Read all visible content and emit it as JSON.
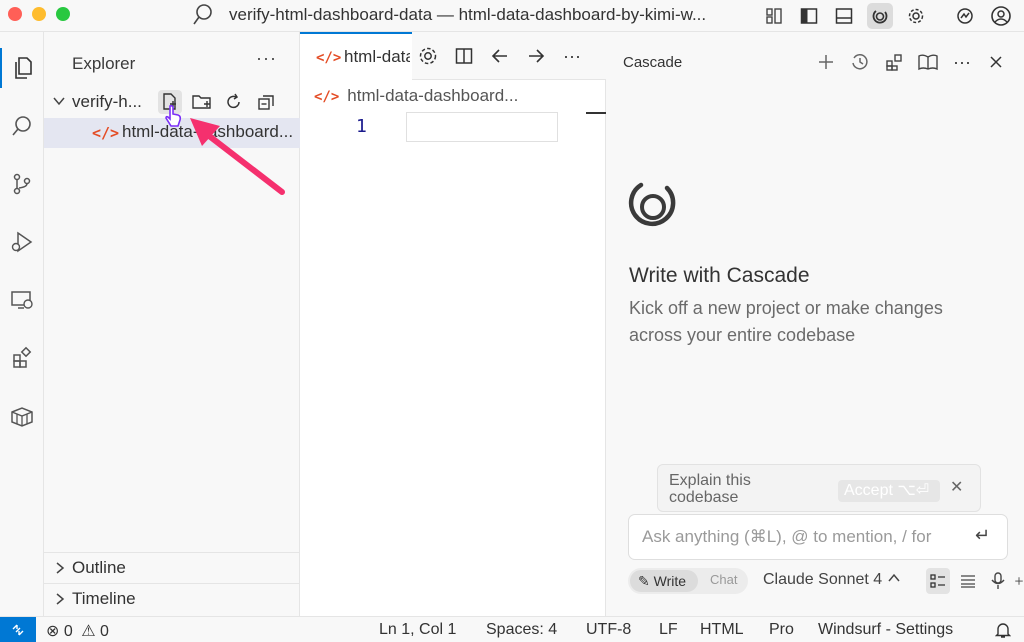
{
  "titlebar": {
    "title": "verify-html-dashboard-data — html-data-dashboard-by-kimi-w..."
  },
  "activity_bar": {
    "items": [
      "explorer-icon",
      "search-icon",
      "source-control-icon",
      "run-debug-icon",
      "remote-explorer-icon",
      "extensions-icon",
      "containers-icon"
    ]
  },
  "explorer": {
    "title": "Explorer",
    "folder_name": "verify-h...",
    "file_name": "html-data-dashboard...",
    "sections": [
      "Outline",
      "Timeline"
    ]
  },
  "editor": {
    "tab_label": "html-data-dashboard.html",
    "breadcrumb": "html-data-dashboard...",
    "line_number": "1"
  },
  "cascade": {
    "title": "Cascade",
    "heading": "Write with Cascade",
    "subtitle": "Kick off a new project or make changes across your entire codebase",
    "suggestion": "Explain this codebase",
    "accept_label": "Accept ⌥⏎",
    "input_placeholder": "Ask anything (⌘L), @ to mention, / for",
    "mode_write": "Write",
    "mode_chat": "Chat",
    "model": "Claude Sonnet 4"
  },
  "statusbar": {
    "errors": "0",
    "warnings": "0",
    "position": "Ln 1, Col 1",
    "spaces": "Spaces: 4",
    "encoding": "UTF-8",
    "eol": "LF",
    "language": "HTML",
    "plan": "Pro",
    "settings": "Windsurf - Settings"
  },
  "colors": {
    "accent": "#0078d4",
    "html_icon": "#e44d26",
    "annotation_arrow": "#f5306e"
  }
}
